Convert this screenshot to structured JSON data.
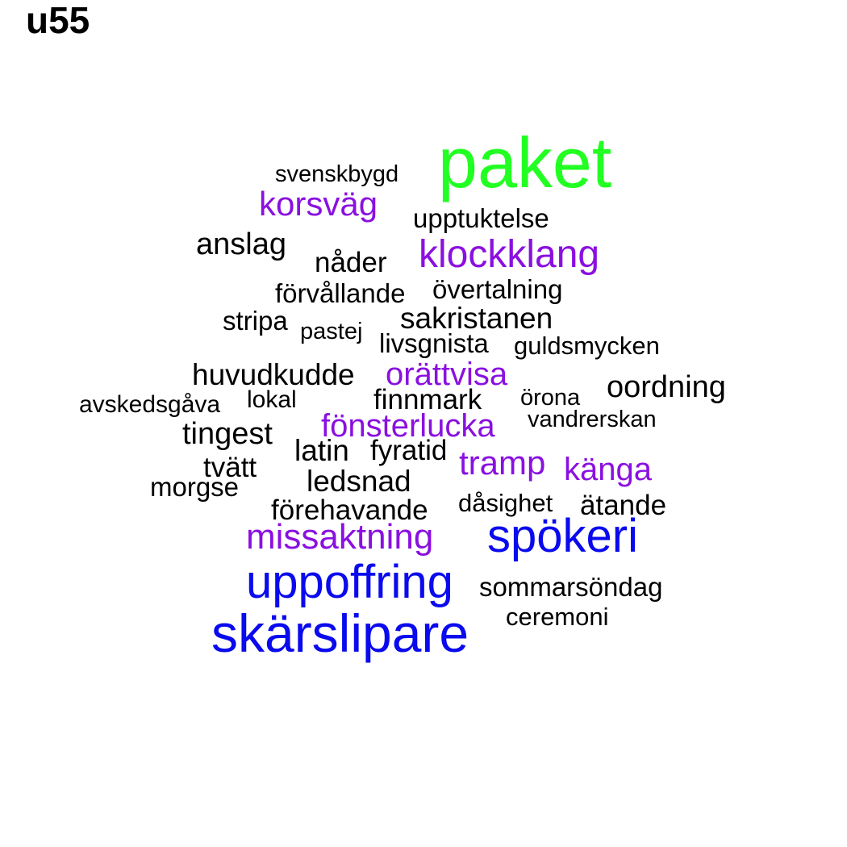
{
  "title": "u55",
  "colors": {
    "black": "#000000",
    "green": "#22ff22",
    "purple": "#8a10e0",
    "blue": "#0a0aee"
  },
  "words": [
    {
      "text": "paket",
      "color": "green"
    },
    {
      "text": "svenskbygd",
      "color": "black"
    },
    {
      "text": "korsväg",
      "color": "purple"
    },
    {
      "text": "upptuktelse",
      "color": "black"
    },
    {
      "text": "anslag",
      "color": "black"
    },
    {
      "text": "nåder",
      "color": "black"
    },
    {
      "text": "klockklang",
      "color": "purple"
    },
    {
      "text": "förvållande",
      "color": "black"
    },
    {
      "text": "övertalning",
      "color": "black"
    },
    {
      "text": "stripa",
      "color": "black"
    },
    {
      "text": "sakristanen",
      "color": "black"
    },
    {
      "text": "pastej",
      "color": "black"
    },
    {
      "text": "livsgnista",
      "color": "black"
    },
    {
      "text": "guldsmycken",
      "color": "black"
    },
    {
      "text": "huvudkudde",
      "color": "black"
    },
    {
      "text": "orättvisa",
      "color": "purple"
    },
    {
      "text": "oordning",
      "color": "black"
    },
    {
      "text": "avskedsgåva",
      "color": "black"
    },
    {
      "text": "lokal",
      "color": "black"
    },
    {
      "text": "finnmark",
      "color": "black"
    },
    {
      "text": "örona",
      "color": "black"
    },
    {
      "text": "fönsterlucka",
      "color": "purple"
    },
    {
      "text": "vandrerskan",
      "color": "black"
    },
    {
      "text": "tingest",
      "color": "black"
    },
    {
      "text": "latin",
      "color": "black"
    },
    {
      "text": "fyratid",
      "color": "black"
    },
    {
      "text": "tvätt",
      "color": "black"
    },
    {
      "text": "tramp",
      "color": "purple"
    },
    {
      "text": "känga",
      "color": "purple"
    },
    {
      "text": "morgse",
      "color": "black"
    },
    {
      "text": "ledsnad",
      "color": "black"
    },
    {
      "text": "dåsighet",
      "color": "black"
    },
    {
      "text": "ätande",
      "color": "black"
    },
    {
      "text": "förehavande",
      "color": "black"
    },
    {
      "text": "missaktning",
      "color": "purple"
    },
    {
      "text": "spökeri",
      "color": "blue"
    },
    {
      "text": "uppoffring",
      "color": "blue"
    },
    {
      "text": "sommarsöndag",
      "color": "black"
    },
    {
      "text": "ceremoni",
      "color": "black"
    },
    {
      "text": "skärslipare",
      "color": "blue"
    }
  ]
}
